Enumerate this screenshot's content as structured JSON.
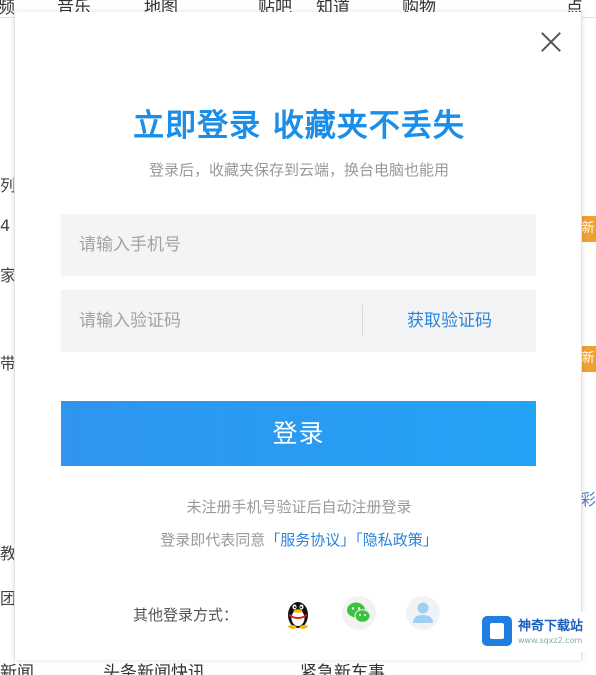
{
  "background": {
    "nav_items": [
      "频",
      "音乐",
      "地图",
      "贴吧",
      "知道",
      "购物",
      "点击"
    ],
    "left_chars": [
      "列",
      "4",
      "家",
      "带",
      "教",
      "团"
    ],
    "right_badges": [
      "新",
      "新"
    ],
    "right_char": "彩",
    "bottom_items": [
      "新闻",
      "头条新闻快讯",
      "紧急新车事"
    ]
  },
  "modal": {
    "title": "立即登录 收藏夹不丢失",
    "subtitle": "登录后，收藏夹保存到云端，换台电脑也能用",
    "phone_placeholder": "请输入手机号",
    "code_placeholder": "请输入验证码",
    "get_code_label": "获取验证码",
    "login_label": "登录",
    "note_auto_register": "未注册手机号验证后自动注册登录",
    "note_agree_prefix": "登录即代表同意",
    "service_agreement": "「服务协议」",
    "privacy_policy": "「隐私政策」",
    "other_login_label": "其他登录方式：",
    "social_icons": [
      "qq-icon",
      "wechat-icon",
      "account-icon"
    ],
    "close_icon": "close-icon"
  },
  "watermark": {
    "title": "神奇下载站",
    "url": "www.sqxz2.com"
  },
  "colors": {
    "accent": "#1a8ee8",
    "button": "#2f95ee",
    "link": "#2b83d8",
    "muted": "#999999",
    "input_bg": "#f3f4f6"
  }
}
